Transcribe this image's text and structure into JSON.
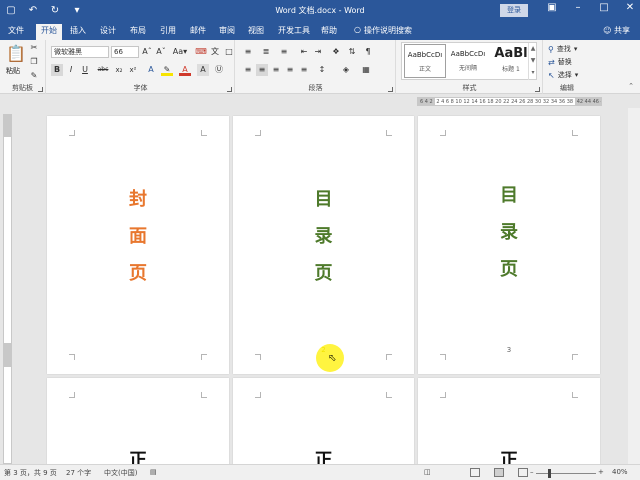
{
  "titlebar": {
    "title": "Word 文档.docx - Word",
    "login_label": "登录",
    "qat": [
      "save-icon",
      "undo-icon",
      "redo-icon",
      "customize-icon"
    ]
  },
  "tabs": [
    {
      "label": "文件",
      "active": false
    },
    {
      "label": "开始",
      "active": true
    },
    {
      "label": "插入",
      "active": false
    },
    {
      "label": "设计",
      "active": false
    },
    {
      "label": "布局",
      "active": false
    },
    {
      "label": "引用",
      "active": false
    },
    {
      "label": "邮件",
      "active": false
    },
    {
      "label": "审阅",
      "active": false
    },
    {
      "label": "视图",
      "active": false
    },
    {
      "label": "开发工具",
      "active": false
    },
    {
      "label": "帮助",
      "active": false
    }
  ],
  "tellme": "操作说明搜索",
  "share": "共享",
  "ribbon": {
    "clipboard": {
      "paste_label": "粘贴",
      "group_label": "剪贴板"
    },
    "font": {
      "font_name": "微软雅黑",
      "font_size": "66",
      "group_label": "字体"
    },
    "paragraph": {
      "group_label": "段落"
    },
    "styles": {
      "group_label": "样式",
      "items": [
        {
          "preview": "AaBbCcDı",
          "name": "正文"
        },
        {
          "preview": "AaBbCcDı",
          "name": "无间隔"
        },
        {
          "preview": "AaBl",
          "name": "标题 1"
        }
      ]
    },
    "editing": {
      "find": "查找",
      "replace": "替换",
      "select": "选择",
      "group_label": "编辑"
    }
  },
  "ruler": {
    "grey_text": "6 4 2",
    "text": "2 4 6 8 10 12 14 16 18 20 22 24 26 28 30 32 34 36 38",
    "end": "42 44 46 48"
  },
  "pages": [
    {
      "chars": [
        "封",
        "面",
        "页"
      ],
      "color": "#e8772e",
      "number": ""
    },
    {
      "chars": [
        "目",
        "录",
        "页"
      ],
      "color": "#4e7a2b",
      "number": "2"
    },
    {
      "chars": [
        "目",
        "录",
        "页"
      ],
      "color": "#4e7a2b",
      "number": "3"
    },
    {
      "chars": [
        "正"
      ],
      "color": "#111111",
      "number": ""
    },
    {
      "chars": [
        "正"
      ],
      "color": "#111111",
      "number": ""
    },
    {
      "chars": [
        "正"
      ],
      "color": "#111111",
      "number": ""
    }
  ],
  "statusbar": {
    "page_info": "第 3 页，共 9 页",
    "word_count": "27 个字",
    "language": "中文(中国)",
    "zoom": "40%"
  }
}
